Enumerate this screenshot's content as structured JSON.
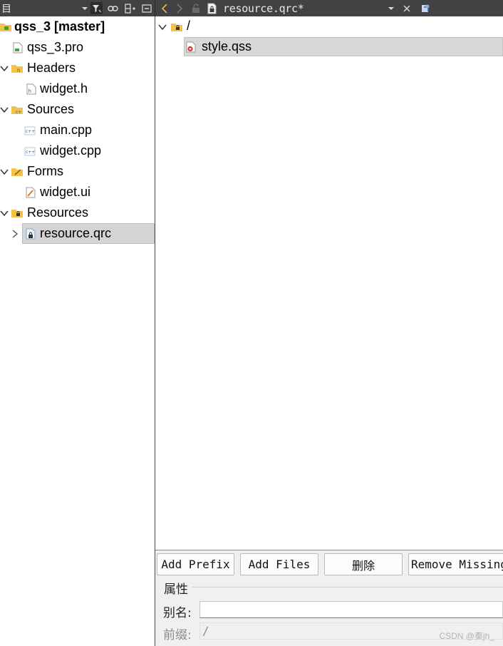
{
  "toolbar": {
    "left_title": "目",
    "open_file": "resource.qrc*"
  },
  "project_tree": {
    "project": {
      "label": "qss_3 [master]"
    },
    "pro_file": {
      "label": "qss_3.pro"
    },
    "headers": {
      "label": "Headers",
      "children": [
        "widget.h"
      ]
    },
    "sources": {
      "label": "Sources",
      "children": [
        "main.cpp",
        "widget.cpp"
      ]
    },
    "forms": {
      "label": "Forms",
      "children": [
        "widget.ui"
      ]
    },
    "resources": {
      "label": "Resources",
      "children": [
        "resource.qrc"
      ]
    }
  },
  "resource_editor": {
    "prefix": "/",
    "files": [
      "style.qss"
    ]
  },
  "buttons": {
    "add_prefix": "Add Prefix",
    "add_files": "Add Files",
    "delete": "删除",
    "remove_missing": "Remove Missing Files"
  },
  "properties": {
    "title": "属性",
    "alias_label": "别名:",
    "alias_value": "",
    "prefix_label": "前缀:",
    "prefix_value": "/"
  },
  "watermark": "CSDN @秦jh_",
  "colors": {
    "toolbar_bg": "#404244",
    "selection_bg": "#d4d4d4",
    "folder": "#f0c44a"
  }
}
